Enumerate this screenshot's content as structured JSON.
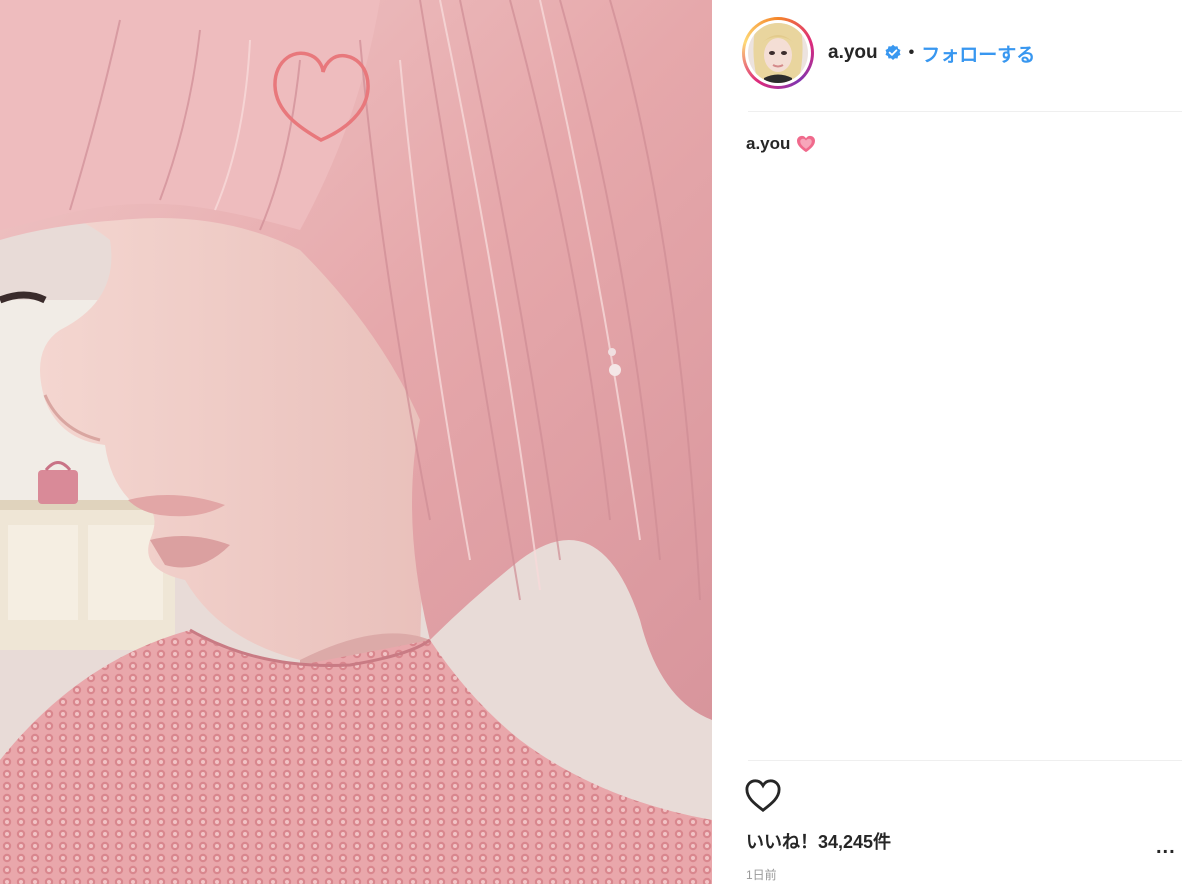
{
  "post": {
    "username": "a.you",
    "separator": "•",
    "follow_label": "フォローする",
    "caption_user": "a.you",
    "likes_text": "いいね！34,245件",
    "timestamp": "1日前",
    "more_label": "..."
  },
  "icons": {
    "verified": "verified-badge-icon",
    "caption_emoji": "pink-heart-emoji",
    "like": "heart-outline-icon",
    "more": "more-options-icon",
    "photo_sticker": "heart-outline-sticker"
  },
  "colors": {
    "link_blue": "#3897f0",
    "text": "#262626",
    "muted": "#999999",
    "sticker_heart": "#e8787c",
    "emoji_heart": "#f06a8c"
  }
}
